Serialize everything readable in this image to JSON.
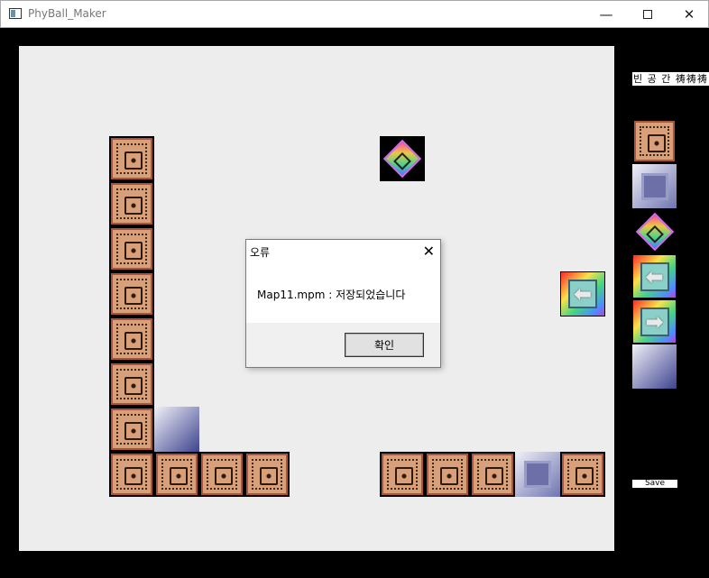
{
  "window": {
    "title": "PhyBall_Maker"
  },
  "panel": {
    "label": "빈 공 간 祷祷祷",
    "save_label": "Save"
  },
  "dialog": {
    "title": "오류",
    "message": "Map11.mpm : 저장되었습니다",
    "ok_label": "확인"
  },
  "palette": [
    "brick-block",
    "glass-block",
    "diamond-block",
    "left-arrow-block",
    "right-arrow-block",
    "gradient-block"
  ],
  "arrow_glyphs": {
    "left": "⬅",
    "right": "➡"
  }
}
